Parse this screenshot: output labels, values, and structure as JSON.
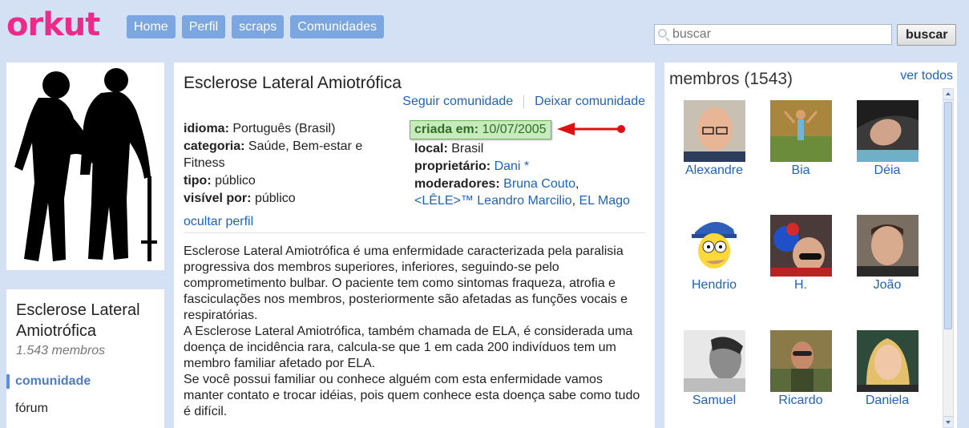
{
  "brand": {
    "logo": "orkut",
    "color": "#ec2a8a"
  },
  "nav": {
    "tabs": [
      "Home",
      "Perfil",
      "scraps",
      "Comunidades"
    ]
  },
  "search": {
    "placeholder": "buscar",
    "button": "buscar"
  },
  "community": {
    "title": "Esclerose Lateral Amiotrófica",
    "follow": "Seguir comunidade",
    "leave": "Deixar comunidade",
    "language_label": "idioma:",
    "language": "Português (Brasil)",
    "category_label": "categoria:",
    "category": "Saúde, Bem-estar e Fitness",
    "type_label": "tipo:",
    "type": "público",
    "visible_label": "visível por:",
    "visible": "público",
    "created_label": "criada em:",
    "created": "10/07/2005",
    "local_label": "local:",
    "local": "Brasil",
    "owner_label": "proprietário:",
    "owner": "Dani *",
    "mods_label": "moderadores:",
    "moderators": [
      "Bruna Couto",
      "<LÊLE>™ Leandro Marcilio",
      "EL Mago"
    ],
    "hide_profile": "ocultar perfil",
    "description": [
      "Esclerose Lateral Amiotrófica é uma enfermidade caracterizada pela paralisia progressiva dos membros superiores, inferiores, seguindo-se pelo comprometimento bulbar. O paciente tem como sintomas fraqueza, atrofia e fasciculações nos membros, posteriormente são afetadas as funções vocais e respiratórias.",
      "A Esclerose Lateral Amiotrófica, também chamada de ELA, é considerada uma doença de incidência rara, calcula-se que 1 em cada 200 indivíduos tem um membro familiar afetado por ELA.",
      "Se você possui familiar ou conhece alguém com esta enfermidade vamos manter contato e trocar idéias, pois quem conhece esta doença sabe como tudo é difícil."
    ]
  },
  "sidebar": {
    "name": "Esclerose Lateral Amiotrófica",
    "members_count": "1.543 membros",
    "menu": [
      "comunidade",
      "fórum"
    ]
  },
  "members": {
    "title": "membros (1543)",
    "see_all": "ver todos",
    "list": [
      "Alexandre",
      "Bia",
      "Déia",
      "Hendrio",
      "H.",
      "João",
      "Samuel",
      "Ricardo",
      "Daniela"
    ]
  }
}
